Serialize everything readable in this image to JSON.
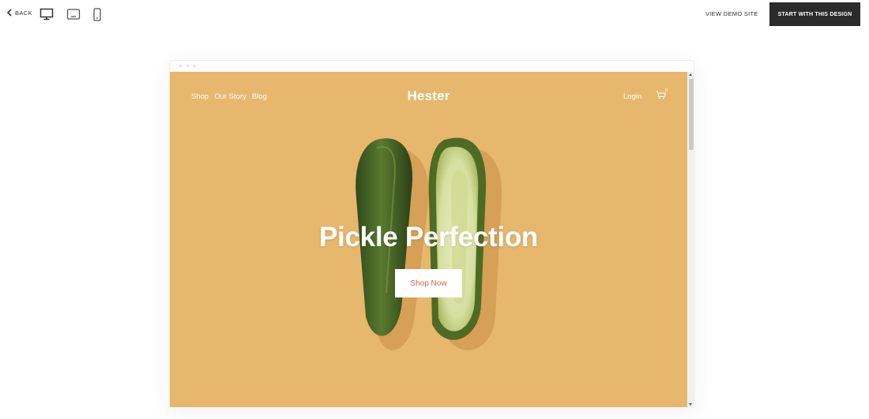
{
  "toolbar": {
    "back_label": "BACK",
    "view_demo_label": "VIEW DEMO SITE",
    "start_label": "START WITH THIS DESIGN",
    "devices": [
      "desktop-icon",
      "tablet-icon",
      "mobile-icon"
    ]
  },
  "site": {
    "nav": [
      {
        "label": "Shop"
      },
      {
        "label": "Our Story"
      },
      {
        "label": "Blog"
      }
    ],
    "brand": "Hester",
    "login_label": "Login",
    "cart_count": "0",
    "hero_title": "Pickle Perfection",
    "cta_label": "Shop Now",
    "colors": {
      "background": "#e6b76d",
      "cta_text": "#d2694a",
      "start_button": "#2b2b2b"
    }
  }
}
